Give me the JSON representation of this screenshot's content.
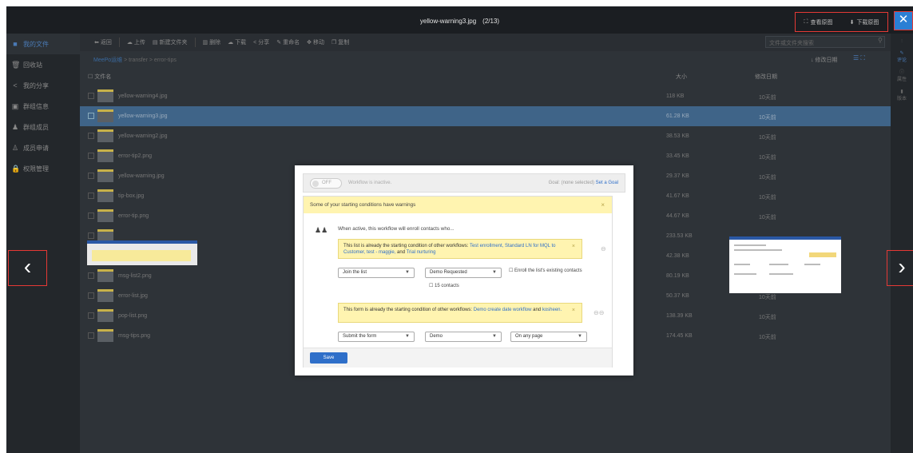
{
  "viewer": {
    "filename": "yellow-warning3.jpg",
    "counter": "(2/13)",
    "view_original": "查看原图",
    "download_original": "下载原图",
    "close": "✕",
    "prev": "‹",
    "next": "›"
  },
  "sidebar": {
    "items": [
      {
        "icon": "■",
        "label": "我的文件",
        "active": true
      },
      {
        "icon": "🗑",
        "label": "回收站"
      },
      {
        "icon": "<",
        "label": "我的分享"
      },
      {
        "icon": "▣",
        "label": "群组信息"
      },
      {
        "icon": "♟",
        "label": "群组成员"
      },
      {
        "icon": "♙",
        "label": "成员申请"
      },
      {
        "icon": "🔒",
        "label": "权限管理"
      }
    ]
  },
  "toolbar": {
    "back": "返回",
    "upload": "上传",
    "new_folder": "新建文件夹",
    "delete": "删除",
    "download": "下载",
    "share": "分享",
    "rename": "重命名",
    "move": "移动",
    "copy": "复制",
    "search_placeholder": "文件或文件夹搜索"
  },
  "breadcrumb": {
    "root": "MeePo运维",
    "path": " > transfer > error-tips"
  },
  "sort": {
    "label": "↓ 修改日期"
  },
  "table": {
    "col_name": "文件名",
    "col_size": "大小",
    "col_date": "修改日期",
    "rows": [
      {
        "name": "yellow-warning4.jpg",
        "size": "118 KB",
        "date": "10天前"
      },
      {
        "name": "yellow-warning3.jpg",
        "size": "61.28 KB",
        "date": "10天前",
        "selected": true
      },
      {
        "name": "yellow-warning2.jpg",
        "size": "38.53 KB",
        "date": "10天前"
      },
      {
        "name": "error-tip2.png",
        "size": "33.45 KB",
        "date": "10天前"
      },
      {
        "name": "yellow-warning.jpg",
        "size": "29.37 KB",
        "date": "10天前"
      },
      {
        "name": "tip-box.jpg",
        "size": "41.67 KB",
        "date": "10天前"
      },
      {
        "name": "error-tip.png",
        "size": "44.67 KB",
        "date": "10天前"
      },
      {
        "name": "",
        "size": "233.53 KB",
        "date": ""
      },
      {
        "name": "",
        "size": "42.38 KB",
        "date": ""
      },
      {
        "name": "msg-list2.png",
        "size": "80.19 KB",
        "date": "10天前"
      },
      {
        "name": "error-list.jpg",
        "size": "50.37 KB",
        "date": "10天前"
      },
      {
        "name": "pop-list.png",
        "size": "138.39 KB",
        "date": "10天前"
      },
      {
        "name": "msg-tips.png",
        "size": "174.45 KB",
        "date": "10天前"
      }
    ]
  },
  "rightbar": {
    "comment": "评论",
    "info": "属性",
    "version": "版本"
  },
  "image": {
    "toggle": "OFF",
    "status": "Workflow is inactive.",
    "goal_prefix": "Goal: (none selected)",
    "goal_link": "Set a Goal",
    "warn_title": "Some of your starting conditions have warnings",
    "when_text": "When active, this workflow will enroll contacts who...",
    "w1_text": "This list is already the starting condition of other workflows:",
    "w1_links": "Test enrollment, Standard LN for MQL to Customer, test - maggie,",
    "w1_and": "and",
    "w1_last": "Trial nurturing",
    "sel1": "Join the list",
    "sel2": "Demo Requested",
    "enroll_existing": "Enroll the list's existing contacts",
    "contacts": "15 contacts",
    "w2_text": "This form is already the starting condition of other workflows:",
    "w2_links": "Demo create date workflow",
    "w2_and": "and",
    "w2_last": "kosheen.",
    "sel3": "Submit the form",
    "sel4": "Demo",
    "sel5": "On any page",
    "save": "Save"
  }
}
